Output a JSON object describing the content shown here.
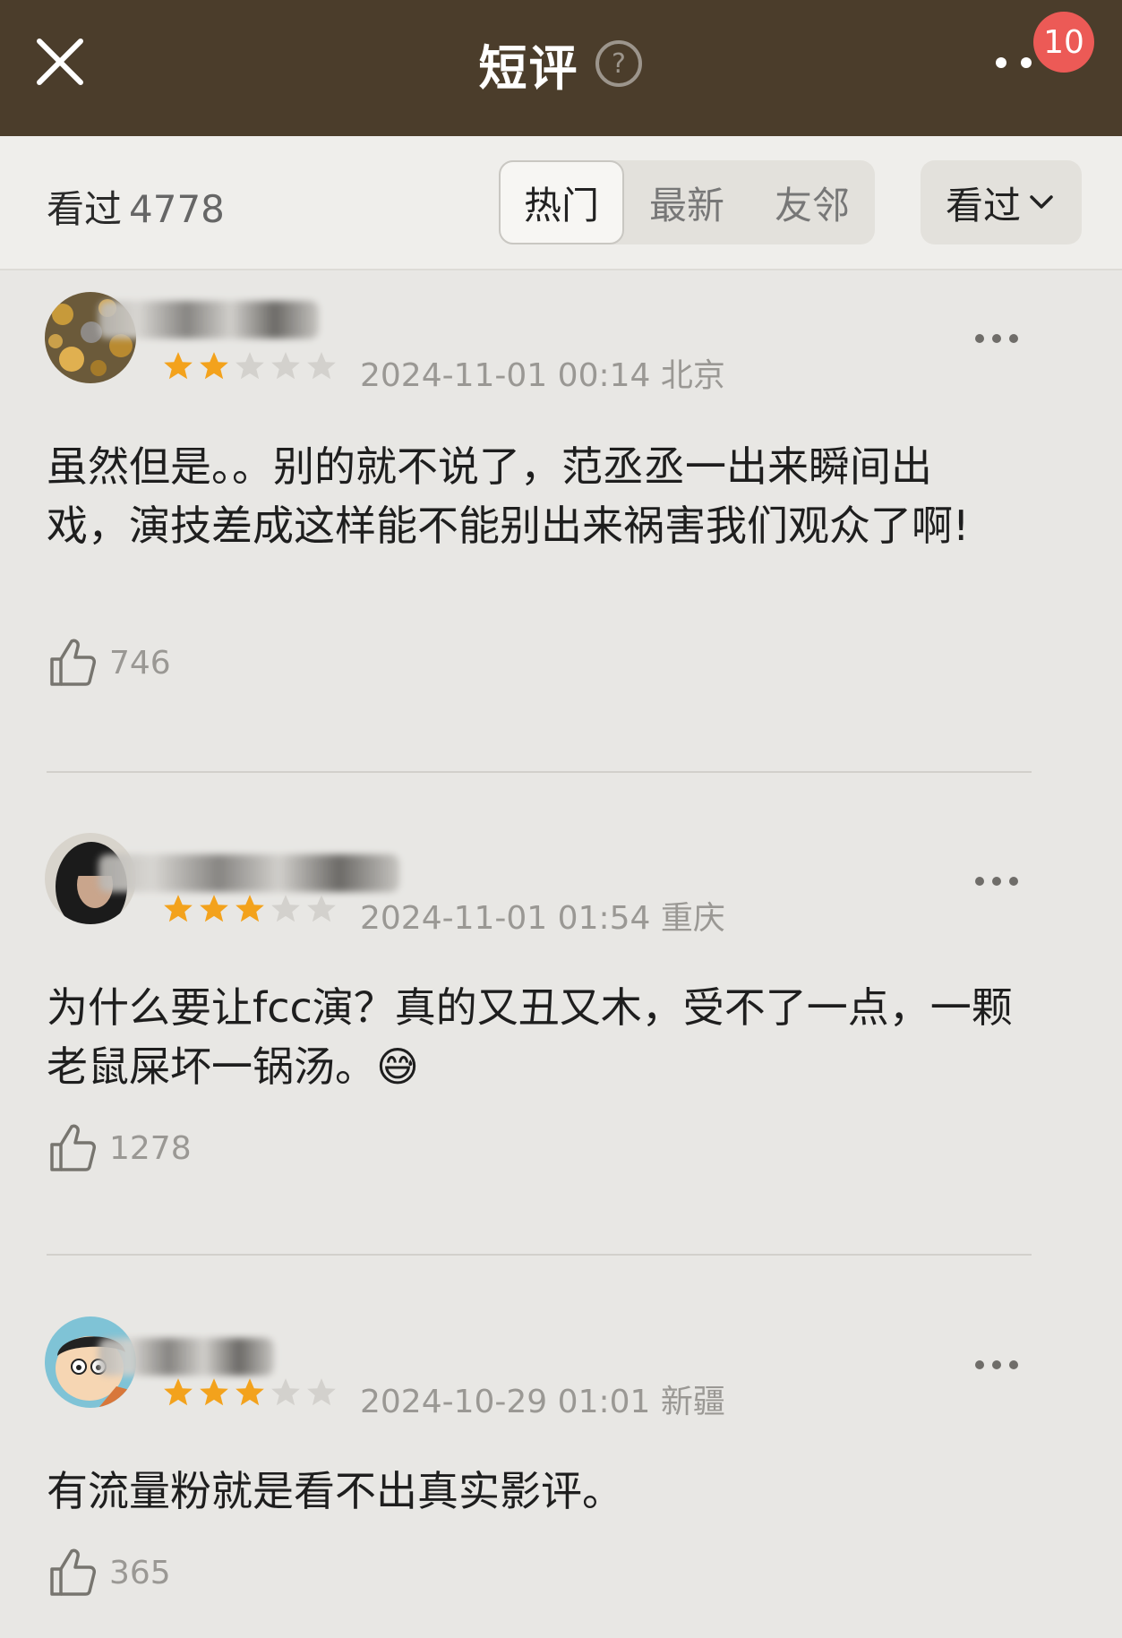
{
  "header": {
    "title": "短评",
    "badge_count": "10",
    "icons": [
      "close-icon",
      "help-icon",
      "more-icon"
    ]
  },
  "filter": {
    "seen_label": "看过",
    "seen_count": "4778",
    "tabs": [
      {
        "label": "热门",
        "active": true
      },
      {
        "label": "最新",
        "active": false
      },
      {
        "label": "友邻",
        "active": false
      }
    ],
    "dropdown_label": "看过"
  },
  "reviews": [
    {
      "rating": 2,
      "date": "2024-11-01 00:14",
      "location": "北京",
      "text": "虽然但是。。别的就不说了，范丞丞一出来瞬间出戏，演技差成这样能不能别出来祸害我们观众了啊!",
      "likes": "746"
    },
    {
      "rating": 3,
      "date": "2024-11-01 01:54",
      "location": "重庆",
      "text": "为什么要让fcc演？真的又丑又木，受不了一点，一颗老鼠屎坏一锅汤。😅",
      "likes": "1278"
    },
    {
      "rating": 3,
      "date": "2024-10-29 01:01",
      "location": "新疆",
      "text": "有流量粉就是看不出真实影评。",
      "likes": "365"
    }
  ],
  "colors": {
    "header_bg": "#4b3d2b",
    "page_bg": "#e8e7e4",
    "star_on": "#f3a21c",
    "star_off": "#d3d1cd",
    "badge": "#ec5a56"
  }
}
